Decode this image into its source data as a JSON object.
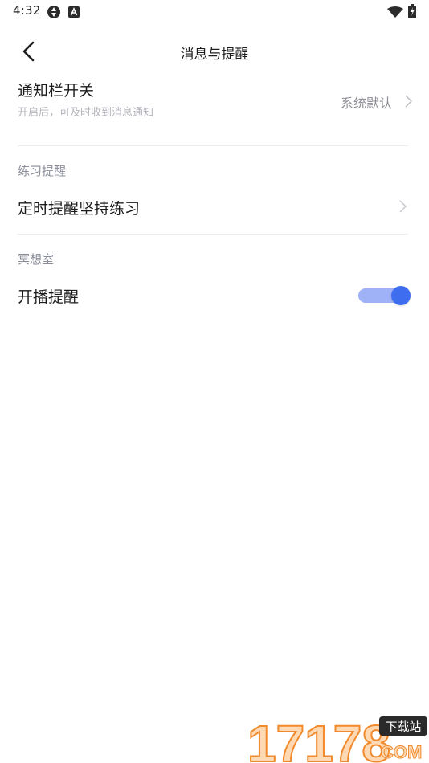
{
  "status_bar": {
    "time": "4:32",
    "icons": [
      "aperture-icon",
      "app-a-icon",
      "wifi-icon",
      "battery-charging-icon"
    ]
  },
  "header": {
    "back_icon": "chevron-left-icon",
    "title": "消息与提醒"
  },
  "notification_switch": {
    "title": "通知栏开关",
    "subtitle": "开启后，可及时收到消息通知",
    "value": "系统默认",
    "chevron_icon": "chevron-right-icon"
  },
  "practice_section": {
    "label": "练习提醒",
    "items": [
      {
        "title": "定时提醒坚持练习",
        "chevron_icon": "chevron-right-icon"
      }
    ]
  },
  "meditation_section": {
    "label": "冥想室",
    "items": [
      {
        "title": "开播提醒",
        "toggle_on": true
      }
    ]
  },
  "colors": {
    "accent": "#3e6df0",
    "accent_track": "#9fb1f7",
    "divider": "#ececef",
    "section_label": "#8a8d99",
    "subtitle": "#b4b4bc",
    "watermark_orange": "#f08a2c"
  },
  "watermark": {
    "text": "17178",
    "badge": "下载站",
    "domain": "COM"
  }
}
